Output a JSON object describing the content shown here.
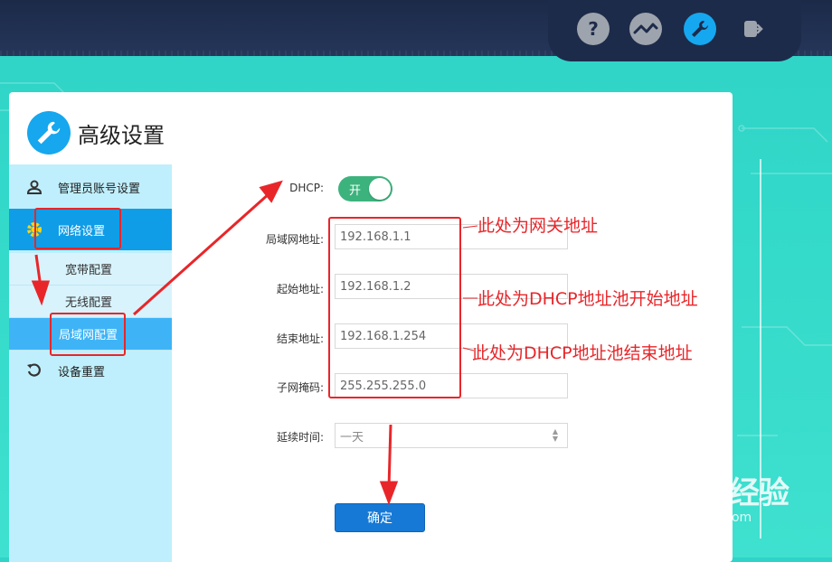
{
  "header": {
    "icons": [
      "help-icon",
      "status-icon",
      "settings-wrench-icon",
      "logout-icon"
    ]
  },
  "panel": {
    "title": "高级设置"
  },
  "sidebar": {
    "items": [
      {
        "label": "管理员账号设置",
        "icon": "user-icon"
      },
      {
        "label": "网络设置",
        "icon": "gear-icon"
      },
      {
        "label": "设备重置",
        "icon": "reset-icon"
      }
    ],
    "subitems": [
      {
        "label": "宽带配置"
      },
      {
        "label": "无线配置"
      },
      {
        "label": "局域网配置"
      }
    ]
  },
  "form": {
    "dhcp_label": "DHCP:",
    "dhcp_toggle": "开",
    "fields": [
      {
        "label": "局域网地址:",
        "value": "192.168.1.1"
      },
      {
        "label": "起始地址:",
        "value": "192.168.1.2"
      },
      {
        "label": "结束地址:",
        "value": "192.168.1.254"
      },
      {
        "label": "子网掩码:",
        "value": "255.255.255.0"
      }
    ],
    "lease_label": "延续时间:",
    "lease_value": "一天",
    "confirm": "确定"
  },
  "annotations": {
    "gateway": "此处为网关地址",
    "pool_start": "此处为DHCP地址池开始地址",
    "pool_end": "此处为DHCP地址池结束地址",
    "color": "#e8262a"
  },
  "watermark": {
    "main": "Baidu经验",
    "sub": "jingyan.baidu.com"
  },
  "colors": {
    "accent": "#0f9de8",
    "toggle_on": "#3cb37d",
    "button": "#1679d6"
  }
}
